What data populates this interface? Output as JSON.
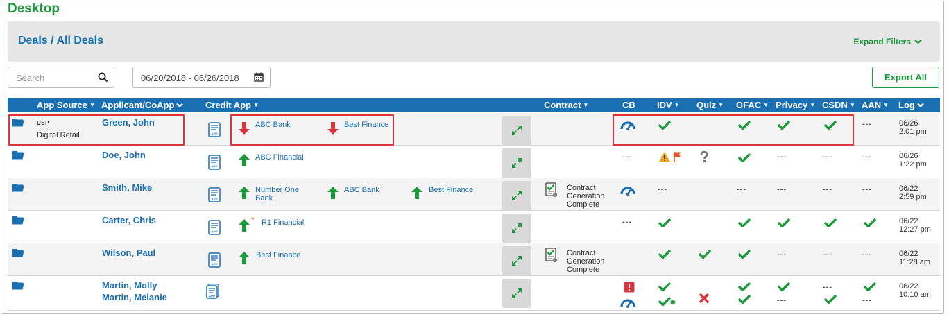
{
  "app_title": "Desktop",
  "header": {
    "breadcrumb": "Deals / All Deals",
    "expand_filters": "Expand Filters"
  },
  "search": {
    "placeholder": "Search",
    "value": ""
  },
  "date_range": "06/20/2018 - 06/26/2018",
  "export_label": "Export All",
  "columns": {
    "app_source": "App Source",
    "applicant": "Applicant/CoApp",
    "credit_app": "Credit App",
    "contract": "Contract",
    "cb": "CB",
    "idv": "IDV",
    "quiz": "Quiz",
    "ofac": "OFAC",
    "privacy": "Privacy",
    "csdn": "CSDN",
    "aan": "AAN",
    "log": "Log"
  },
  "dash": "---",
  "colors": {
    "brand_green": "#1a9a3a",
    "link_blue": "#1a6fb3",
    "header_blue": "#1a6fb3",
    "arrow_up": "#1a9a3a",
    "arrow_down": "#d9363e",
    "highlight_red": "#d9363e"
  },
  "rows": [
    {
      "source_logo": "DSP",
      "source_name": "Digital Retail",
      "applicant": "Green, John",
      "lenders": [
        {
          "name": "ABC Bank",
          "direction": "down"
        },
        {
          "name": "Best Finance",
          "direction": "down"
        }
      ],
      "contract": "",
      "cb": "gauge-icon",
      "idv": "check",
      "quiz": "",
      "ofac": "check",
      "privacy": "check",
      "csdn": "check",
      "aan": "---",
      "log_date": "06/26",
      "log_time": "2:01 pm"
    },
    {
      "applicant": "Doe, John",
      "lenders": [
        {
          "name": "ABC Financial",
          "direction": "up"
        }
      ],
      "contract": "",
      "cb": "---",
      "idv": "warning-flag",
      "quiz": "question",
      "ofac": "check",
      "privacy": "---",
      "csdn": "---",
      "aan": "---",
      "log_date": "06/26",
      "log_time": "1:22 pm"
    },
    {
      "applicant": "Smith, Mike",
      "lenders": [
        {
          "name": "Number One Bank",
          "direction": "up"
        },
        {
          "name": "ABC Bank",
          "direction": "up"
        },
        {
          "name": "Best Finance",
          "direction": "up"
        }
      ],
      "contract": "Contract Generation Complete",
      "cb": "gauge-icon",
      "idv": "---",
      "quiz": "",
      "ofac": "---",
      "privacy": "---",
      "csdn": "---",
      "aan": "---",
      "log_date": "06/22",
      "log_time": "2:59 pm"
    },
    {
      "applicant": "Carter, Chris",
      "lenders": [
        {
          "name": "R1 Financial",
          "direction": "up",
          "asterisk": "*"
        }
      ],
      "contract": "",
      "cb": "---",
      "idv": "check",
      "quiz": "",
      "ofac": "check",
      "privacy": "check",
      "csdn": "check",
      "aan": "check",
      "log_date": "06/22",
      "log_time": "12:27 pm"
    },
    {
      "applicant": "Wilson, Paul",
      "lenders": [
        {
          "name": "Best Finance",
          "direction": "up"
        }
      ],
      "contract": "Contract Generation Complete",
      "cb": "",
      "idv": "check",
      "quiz": "check",
      "ofac": "check",
      "privacy": "---",
      "csdn": "---",
      "aan": "---",
      "log_date": "06/22",
      "log_time": "11:28 am"
    },
    {
      "applicant": "Martin, Molly",
      "coapplicant": "Martin, Melanie",
      "lenders": [],
      "contract": "",
      "cb": "alert + gauge",
      "idv": "check / check-star",
      "quiz": "cross",
      "ofac": "check / check",
      "privacy": "check / ---",
      "csdn": "--- / check",
      "aan": "check / ---",
      "log_date": "06/22",
      "log_time": "10:10 am"
    }
  ]
}
